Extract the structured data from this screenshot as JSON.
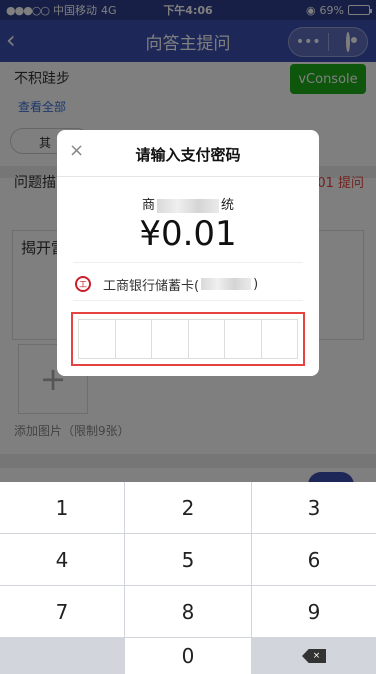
{
  "status": {
    "carrier": "中国移动",
    "network": "4G",
    "time": "下午4:06",
    "battery_text": "69%",
    "battery_level": 0.69
  },
  "nav": {
    "back_icon": "chevron-left-icon",
    "title": "向答主提问",
    "more_label": "•••",
    "close_icon": "target-icon"
  },
  "page": {
    "answerer_name": "不积跬步",
    "view_all_link": "查看全部",
    "vconsole_label": "vConsole",
    "chip_label": "其",
    "desc_label": "问题描",
    "desc_right": "01 提问",
    "question_text": "揭开雷",
    "add_image_plus": "+",
    "add_image_tip": "添加图片（限制9张）",
    "toggle_color": "#3b4fb0"
  },
  "dialog": {
    "close_icon_glyph": "×",
    "title": "请输入支付密码",
    "merchant_prefix": "商",
    "merchant_suffix": "统",
    "amount": "¥0.01",
    "bank_icon_glyph": "ICBC",
    "card_label": "工商银行储蓄卡(",
    "card_suffix": ")",
    "highlight_color": "#e64340"
  },
  "keyboard": {
    "keys": [
      "1",
      "2",
      "3",
      "4",
      "5",
      "6",
      "7",
      "8",
      "9",
      "",
      "0",
      "delete"
    ],
    "delete_glyph": "×"
  }
}
